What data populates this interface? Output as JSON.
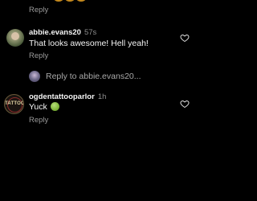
{
  "top": {
    "reply_label": "Reply"
  },
  "comments": [
    {
      "username": "abbie.evans20",
      "time": "57s",
      "text": "That looks awesome! Hell yeah!",
      "reply_label": "Reply",
      "heart_icon": "heart-outline-icon"
    },
    {
      "username": "ogdentattooparlor",
      "time": "1h",
      "text": "Yuck",
      "emoji": "nauseated-face",
      "reply_label": "Reply",
      "heart_icon": "heart-outline-icon"
    }
  ],
  "reply_to": {
    "text": "Reply to abbie.evans20..."
  },
  "colors": {
    "background": "#000000",
    "primary_text": "#f5f5f5",
    "secondary_text": "#9a9a9a",
    "timestamp": "#8e8e8e"
  }
}
